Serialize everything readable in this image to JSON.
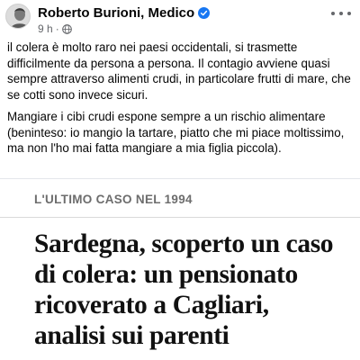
{
  "post": {
    "author": "Roberto Burioni, Medico",
    "time": "9 h",
    "separator": "·",
    "paragraphs": [
      "il colera è molto raro nei paesi occidentali, si trasmette difficilmente da persona a persona. Il contagio avviene quasi sempre attraverso alimenti crudi, in particolare frutti di mare, che se cotti sono invece sicuri.",
      "Mangiare i cibi crudi espone sempre a un rischio alimentare (beninteso: io mangio la tartare, piatto che mi piace moltissimo, ma non l'ho mai fatta mangiare a mia figlia piccola)."
    ]
  },
  "article": {
    "kicker": "L'ULTIMO CASO NEL 1994",
    "headline_lines": [
      "Sardegna, scoperto un caso",
      "di colera: un pensionato",
      "ricoverato a Cagliari,",
      "analisi sui parenti"
    ]
  },
  "icons": {
    "verified": "verified-badge-icon",
    "audience": "globe-icon",
    "more": "more-options-icon"
  },
  "colors": {
    "verified_blue": "#1877f2",
    "meta_gray": "#65676b",
    "kicker_gray": "#6d6d6d"
  }
}
